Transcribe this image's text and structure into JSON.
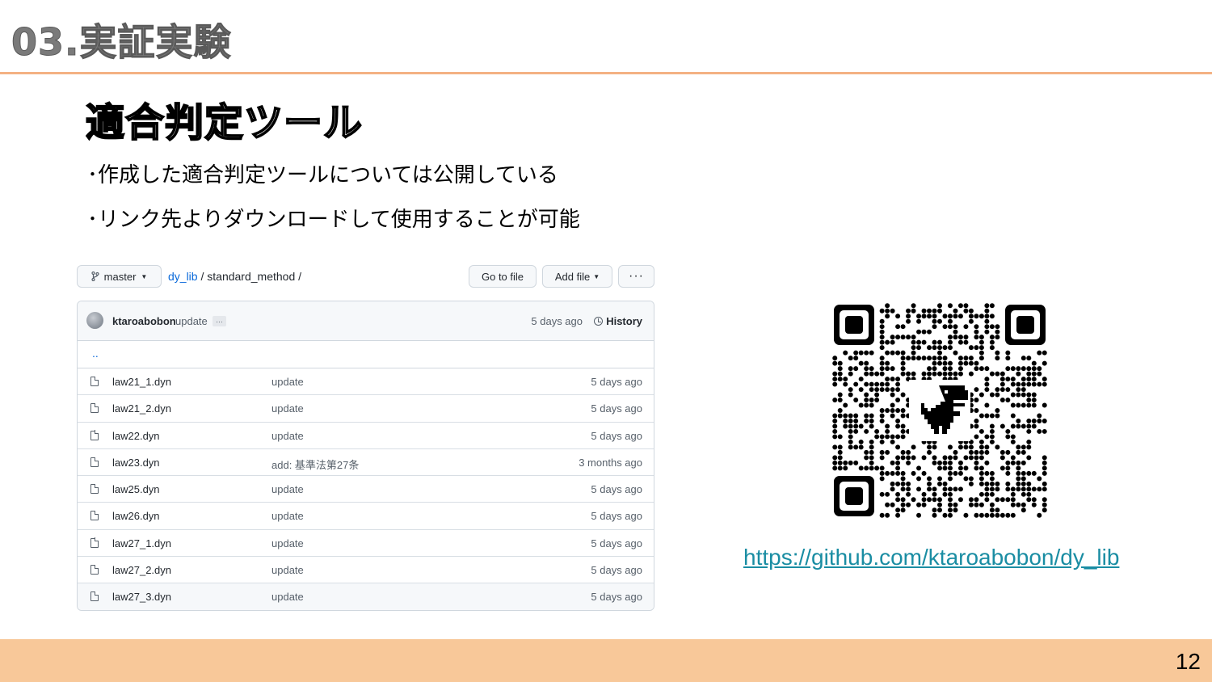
{
  "slide": {
    "title": "03.実証実験",
    "heading": "適合判定ツール",
    "bullets": [
      "･作成した適合判定ツールについては公開している",
      "･リンク先よりダウンロードして使用することが可能"
    ],
    "page_number": "12",
    "url": "https://github.com/ktaroabobon/dy_lib"
  },
  "colors": {
    "title_rule": "#f4b183",
    "footer_band": "#f8c899",
    "link": "#1a8da3",
    "github_link": "#0969da"
  },
  "github": {
    "branch": "master",
    "repo": "dy_lib",
    "path_sep": " / ",
    "path": "standard_method",
    "path_trailing": " /",
    "go_to_file": "Go to file",
    "add_file": "Add file",
    "more": "···",
    "commit": {
      "author": "ktaroabobon",
      "message": "update",
      "ellipsis": "…",
      "time": "5 days ago",
      "history": "History"
    },
    "parent_dir": "..",
    "files": [
      {
        "name": "law21_1.dyn",
        "message": "update",
        "time": "5 days ago"
      },
      {
        "name": "law21_2.dyn",
        "message": "update",
        "time": "5 days ago"
      },
      {
        "name": "law22.dyn",
        "message": "update",
        "time": "5 days ago"
      },
      {
        "name": "law23.dyn",
        "message": "add: 基準法第27条",
        "time": "3 months ago"
      },
      {
        "name": "law25.dyn",
        "message": "update",
        "time": "5 days ago"
      },
      {
        "name": "law26.dyn",
        "message": "update",
        "time": "5 days ago"
      },
      {
        "name": "law27_1.dyn",
        "message": "update",
        "time": "5 days ago"
      },
      {
        "name": "law27_2.dyn",
        "message": "update",
        "time": "5 days ago"
      },
      {
        "name": "law27_3.dyn",
        "message": "update",
        "time": "5 days ago"
      }
    ]
  }
}
